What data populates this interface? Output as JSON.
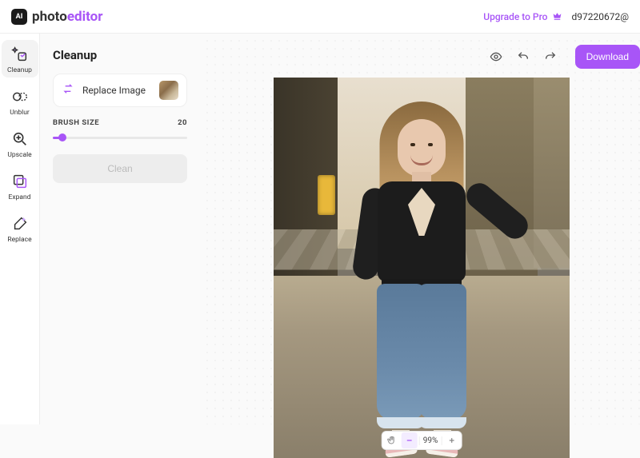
{
  "brand": {
    "ai": "AI",
    "prefix": "photo",
    "suffix": "editor"
  },
  "header": {
    "upgrade_label": "Upgrade to Pro",
    "user_email": "d97220672@",
    "download_label": "Download"
  },
  "tools": {
    "cleanup": "Cleanup",
    "unblur": "Unblur",
    "upscale": "Upscale",
    "expand": "Expand",
    "replace": "Replace"
  },
  "panel": {
    "title": "Cleanup",
    "replace_label": "Replace Image",
    "brush_label": "BRUSH SIZE",
    "brush_value": "20",
    "clean_label": "Clean"
  },
  "zoom": {
    "value": "99%"
  },
  "colors": {
    "accent": "#a855f7"
  }
}
